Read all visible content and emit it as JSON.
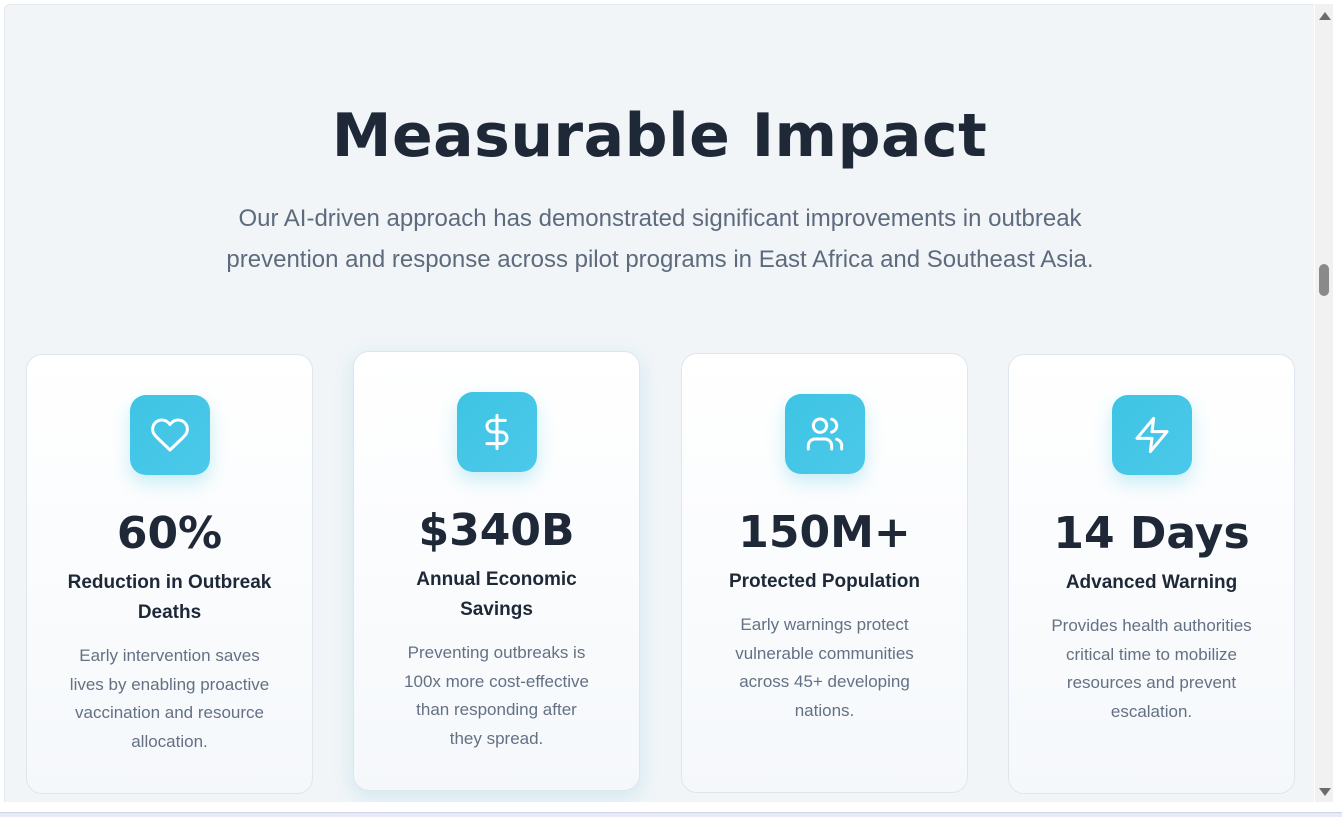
{
  "section": {
    "title": "Measurable Impact",
    "subtitle_line1": "Our AI-driven approach has demonstrated significant improvements in outbreak",
    "subtitle_line2": "prevention and response across pilot programs in East Africa and Southeast Asia."
  },
  "accent_color": "#3ec4e4",
  "cards": [
    {
      "icon": "heart-icon",
      "value": "60%",
      "label_line1": "Reduction in Outbreak",
      "label_line2": "Deaths",
      "desc_lines": [
        "Early intervention saves",
        "lives by enabling proactive",
        "vaccination and resource",
        "allocation."
      ]
    },
    {
      "icon": "dollar-icon",
      "value": "$340B",
      "label_line1": "Annual Economic",
      "label_line2": "Savings",
      "desc_lines": [
        "Preventing outbreaks is",
        "100x more cost-effective",
        "than responding after",
        "they spread."
      ]
    },
    {
      "icon": "users-icon",
      "value": "150M+",
      "label_line1": "Protected Population",
      "label_line2": "",
      "desc_lines": [
        "Early warnings protect",
        "vulnerable communities",
        "across 45+ developing",
        "nations."
      ]
    },
    {
      "icon": "lightning-icon",
      "value": "14 Days",
      "label_line1": "Advanced Warning",
      "label_line2": "",
      "desc_lines": [
        "Provides health authorities",
        "critical time to mobilize",
        "resources and prevent",
        "escalation."
      ]
    }
  ]
}
